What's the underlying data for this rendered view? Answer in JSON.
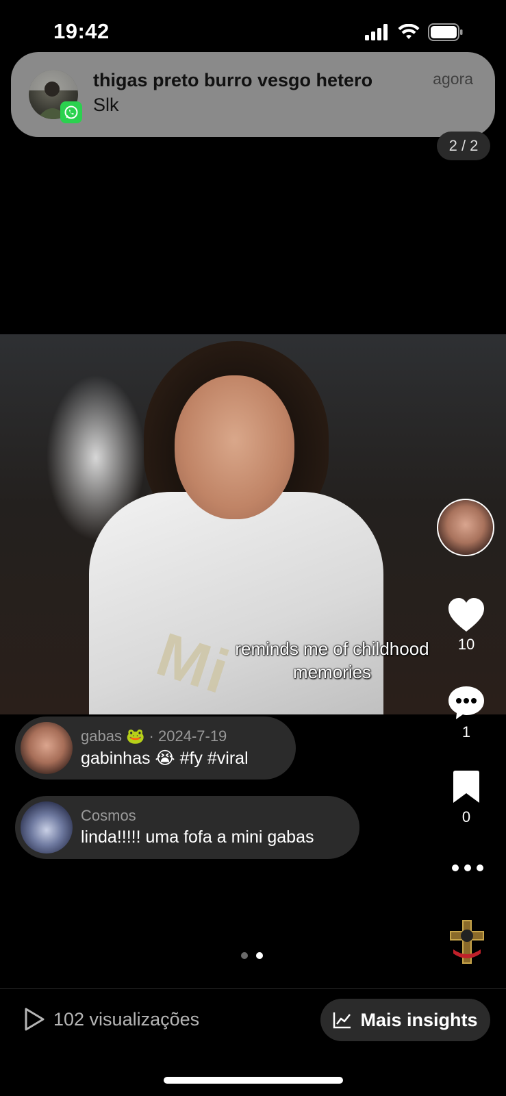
{
  "status_bar": {
    "time": "19:42"
  },
  "notification": {
    "title": "thigas preto burro vesgo hetero",
    "body": "Slk",
    "time": "agora",
    "app_icon": "whatsapp-icon",
    "app_color": "#2bd14f"
  },
  "post": {
    "page_counter": "2 / 2",
    "caption_overlay": "reminds me of childhood memories",
    "photo_sash_text": "Mi",
    "likes": "10",
    "comments": "1",
    "saves": "0",
    "carousel": {
      "total": 2,
      "active_index": 1
    }
  },
  "comments": [
    {
      "author": "gabas 🐸 · 2024-7-19",
      "text": "gabinhas 😭 #fy #viral"
    },
    {
      "author": "Cosmos",
      "text": "linda!!!!! uma fofa a mini gabas"
    }
  ],
  "footer": {
    "views": "102 visualizações",
    "insights_label": "Mais insights"
  },
  "colors": {
    "background": "#000000",
    "bubble": "#2b2b2b",
    "notification_bg": "#8a8a8a",
    "dot_active": "#ffffff",
    "dot_inactive": "#6a6a6a"
  }
}
